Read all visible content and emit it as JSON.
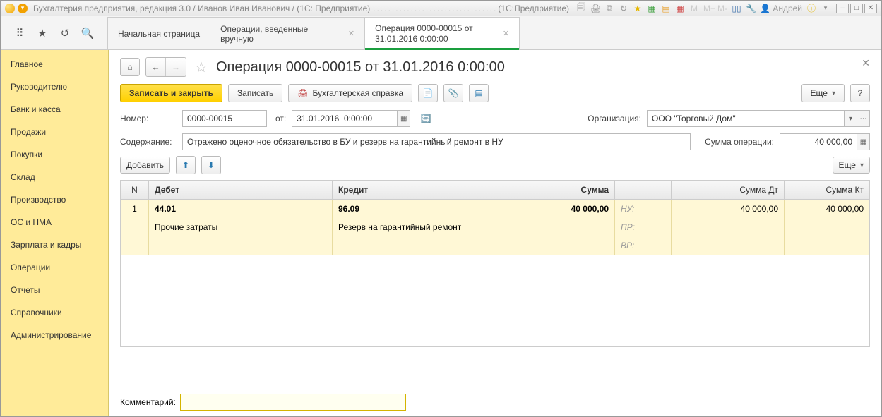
{
  "window": {
    "title_left": "Бухгалтерия предприятия, редакция 3.0 / Иванов Иван Иванович / (1С: Предприятие)",
    "title_right": "(1С:Предприятие)",
    "user": "Андрей"
  },
  "tabs": [
    {
      "label": "Начальная страница",
      "active": false,
      "closable": false
    },
    {
      "label": "Операции, введенные вручную",
      "active": false,
      "closable": true
    },
    {
      "label": "Операция 0000-00015 от 31.01.2016 0:00:00",
      "active": true,
      "closable": true
    }
  ],
  "sidebar": [
    "Главное",
    "Руководителю",
    "Банк и касса",
    "Продажи",
    "Покупки",
    "Склад",
    "Производство",
    "ОС и НМА",
    "Зарплата и кадры",
    "Операции",
    "Отчеты",
    "Справочники",
    "Администрирование"
  ],
  "page": {
    "title": "Операция 0000-00015 от 31.01.2016 0:00:00",
    "toolbar": {
      "save_close": "Записать и закрыть",
      "save": "Записать",
      "accounting_note": "Бухгалтерская справка",
      "more": "Еще"
    },
    "fields": {
      "number_label": "Номер:",
      "number_value": "0000-00015",
      "from_label": "от:",
      "date_value": "31.01.2016  0:00:00",
      "org_label": "Организация:",
      "org_value": "ООО \"Торговый Дом\"",
      "content_label": "Содержание:",
      "content_value": "Отражено оценочное обязательство в БУ и резерв на гарантийный ремонт в НУ",
      "sum_label": "Сумма операции:",
      "sum_value": "40 000,00",
      "add": "Добавить",
      "more2": "Еще",
      "comment_label": "Комментарий:",
      "comment_value": ""
    },
    "table": {
      "headers": {
        "n": "N",
        "debet": "Дебет",
        "kredit": "Кредит",
        "sum": "Сумма",
        "sum_dt": "Сумма Дт",
        "sum_kt": "Сумма Кт"
      },
      "rows": [
        {
          "n": "1",
          "debet_acct": "44.01",
          "debet_name": "Прочие затраты",
          "kredit_acct": "96.09",
          "kredit_name": "Резерв на гарантийный ремонт",
          "sum": "40 000,00",
          "tax": [
            {
              "lbl": "НУ:",
              "dt": "40 000,00",
              "kt": "40 000,00"
            },
            {
              "lbl": "ПР:",
              "dt": "",
              "kt": ""
            },
            {
              "lbl": "ВР:",
              "dt": "",
              "kt": ""
            }
          ]
        }
      ]
    }
  }
}
